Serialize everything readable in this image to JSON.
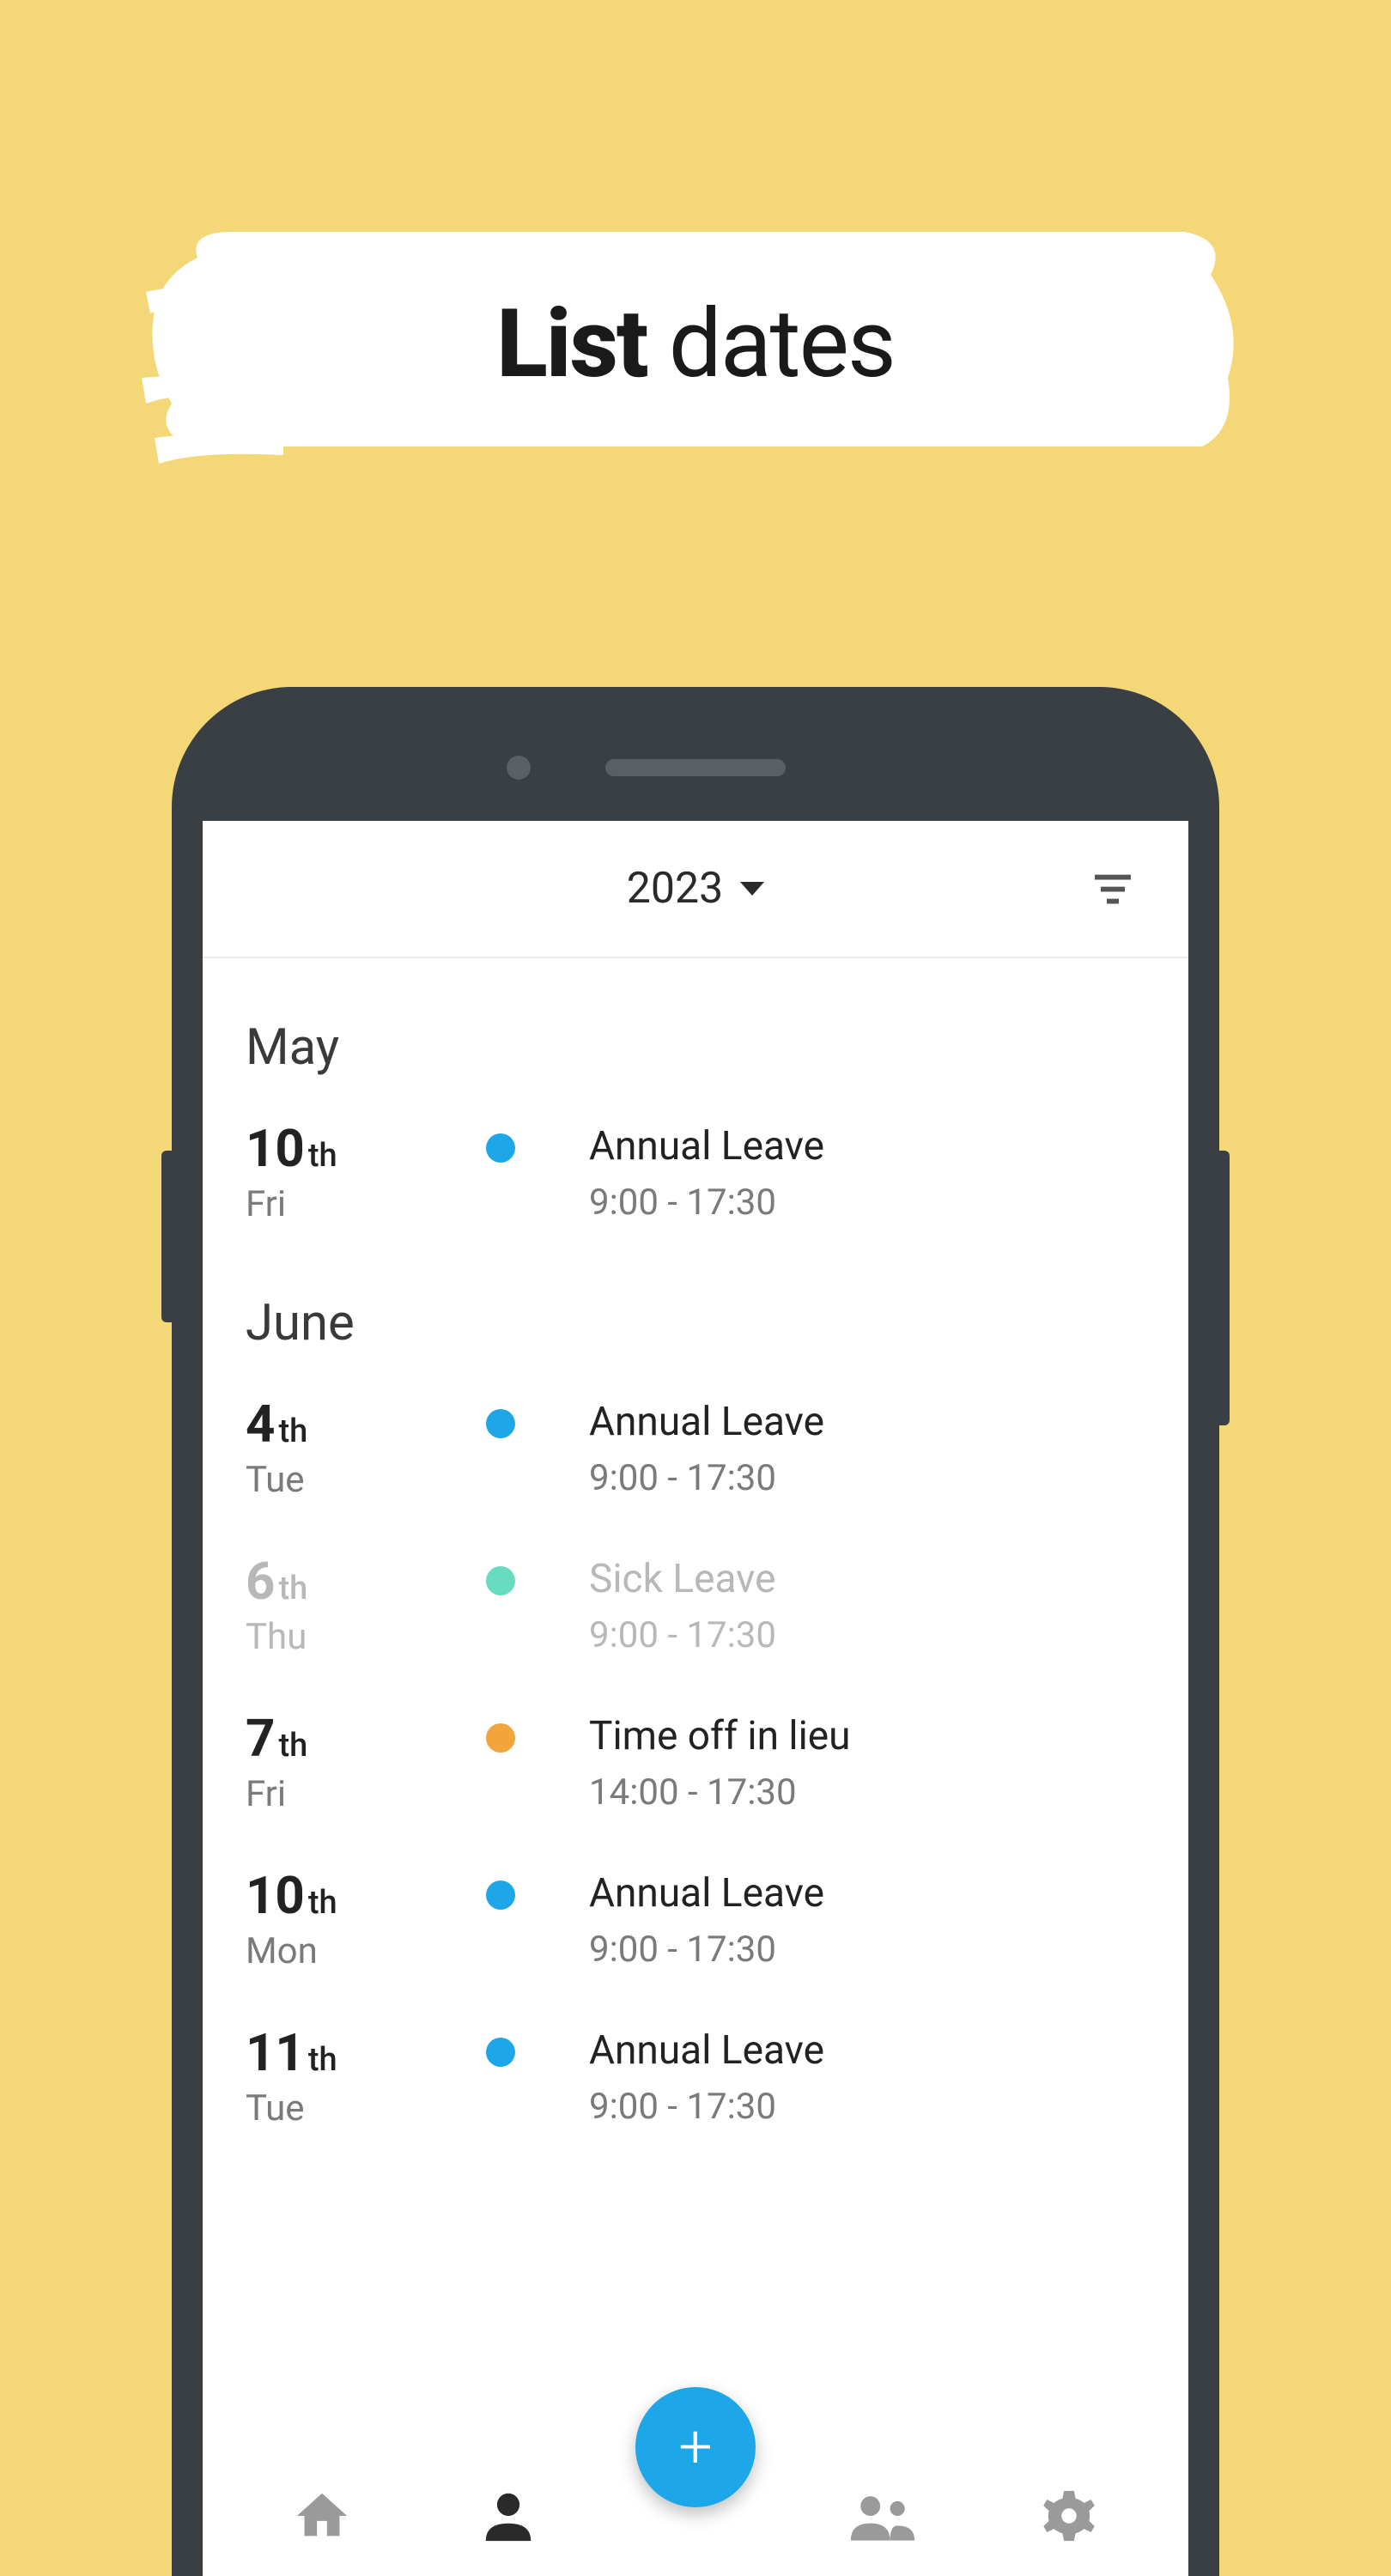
{
  "banner": {
    "title_bold": "List",
    "title_light": "dates"
  },
  "topbar": {
    "year": "2023"
  },
  "colors": {
    "blue": "#1ea7e8",
    "teal": "#67dcc1",
    "orange": "#f2a53c"
  },
  "months": [
    {
      "name": "May",
      "events": [
        {
          "day": "10",
          "ord": "th",
          "dow": "Fri",
          "color_key": "blue",
          "title": "Annual Leave",
          "time": "9:00 - 17:30",
          "dim": false
        }
      ]
    },
    {
      "name": "June",
      "events": [
        {
          "day": "4",
          "ord": "th",
          "dow": "Tue",
          "color_key": "blue",
          "title": "Annual Leave",
          "time": "9:00 - 17:30",
          "dim": false
        },
        {
          "day": "6",
          "ord": "th",
          "dow": "Thu",
          "color_key": "teal",
          "title": "Sick Leave",
          "time": "9:00 - 17:30",
          "dim": true
        },
        {
          "day": "7",
          "ord": "th",
          "dow": "Fri",
          "color_key": "orange",
          "title": "Time off in lieu",
          "time": "14:00 - 17:30",
          "dim": false
        },
        {
          "day": "10",
          "ord": "th",
          "dow": "Mon",
          "color_key": "blue",
          "title": "Annual Leave",
          "time": "9:00 - 17:30",
          "dim": false
        },
        {
          "day": "11",
          "ord": "th",
          "dow": "Tue",
          "color_key": "blue",
          "title": "Annual Leave",
          "time": "9:00 - 17:30",
          "dim": false
        }
      ]
    }
  ],
  "fab": {
    "label": "+"
  }
}
